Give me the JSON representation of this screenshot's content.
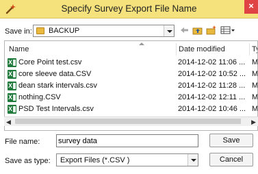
{
  "window": {
    "title": "Specify Survey Export File Name"
  },
  "save_in": {
    "label": "Save in:",
    "value": "BACKUP"
  },
  "columns": {
    "name": "Name",
    "date_modified": "Date modified",
    "type": "Ty"
  },
  "files": [
    {
      "name": "Core Point test.csv",
      "date": "2014-12-02 11:06 ...",
      "type": "M"
    },
    {
      "name": "core sleeve data.CSV",
      "date": "2014-12-02 10:52 ...",
      "type": "M"
    },
    {
      "name": "dean stark intervals.csv",
      "date": "2014-12-02 11:28 ...",
      "type": "M"
    },
    {
      "name": "nothing.CSV",
      "date": "2014-12-02 12:11 ...",
      "type": "M"
    },
    {
      "name": "PSD Test Intervals.csv",
      "date": "2014-12-02 10:46 ...",
      "type": "M"
    }
  ],
  "file_name": {
    "label": "File name:",
    "value": "survey data"
  },
  "save_as_type": {
    "label": "Save as type:",
    "value": "Export Files (*.CSV )"
  },
  "buttons": {
    "save": "Save",
    "cancel": "Cancel"
  },
  "icons": {
    "app": "wand-icon",
    "folder": "folder-icon",
    "back": "back-arrow-icon",
    "up": "up-folder-icon",
    "new_folder": "new-folder-icon",
    "views": "view-menu-icon",
    "file": "csv-file-icon"
  }
}
